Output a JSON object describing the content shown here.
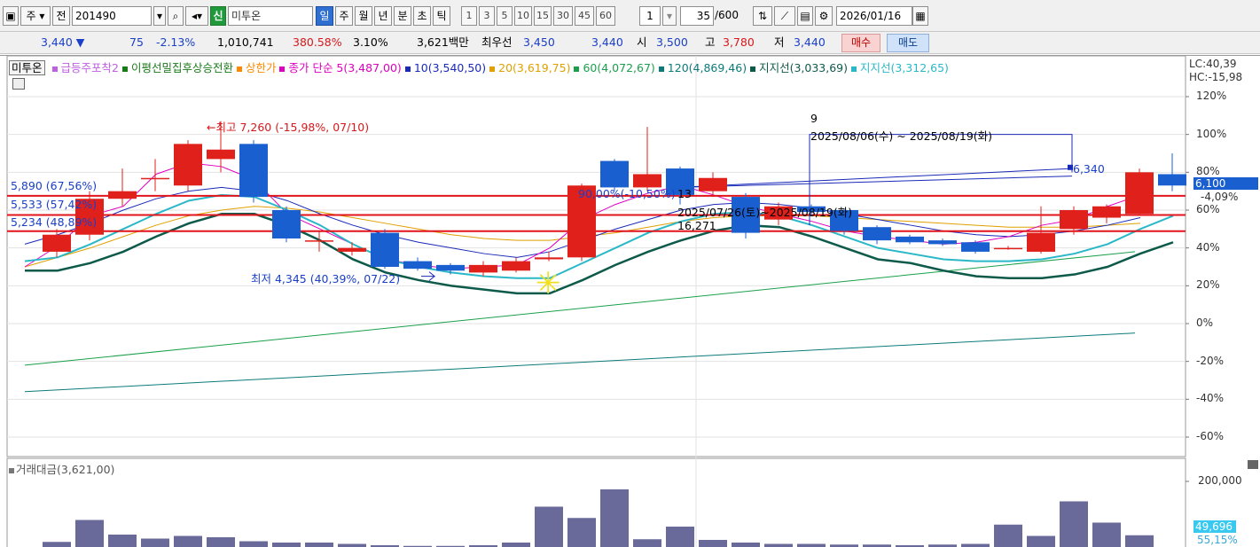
{
  "toolbar": {
    "type_label": "주",
    "prefix_label": "전",
    "code_value": "201490",
    "market_badge": "신",
    "stock_name": "미투온",
    "period_buttons": [
      "일",
      "주",
      "월",
      "년",
      "분",
      "초",
      "틱"
    ],
    "active_period": "일",
    "interval_buttons": [
      "1",
      "3",
      "5",
      "10",
      "15",
      "30",
      "45",
      "60"
    ],
    "interval_value": "1",
    "count_value": "35",
    "count_total": "/600",
    "date_value": "2026/01/16"
  },
  "info": {
    "price": "3,440",
    "change_arrow": "▼",
    "change": "75",
    "change_pct": "-2.13%",
    "volume": "1,010,741",
    "volume_ratio": "380.58%",
    "turnover": "3.10%",
    "amount": "3,621백만",
    "quote_label": "최우선",
    "ask": "3,450",
    "bid": "3,440",
    "open_label": "시",
    "open": "3,500",
    "high_label": "고",
    "high": "3,780",
    "low_label": "저",
    "low": "3,440",
    "buy_label": "매수",
    "sell_label": "매도"
  },
  "legend": {
    "name": "미투온",
    "items": [
      {
        "text": "급등주포착2",
        "color": "#c060e0"
      },
      {
        "text": "이평선밀집후상승전환",
        "color": "#1a7a1a"
      },
      {
        "text": "상한가",
        "color": "#ff8800"
      },
      {
        "text": "종가 단순 5(3,487,00)",
        "color": "#e000c0"
      },
      {
        "text": "10(3,540,50)",
        "color": "#1a2ab8"
      },
      {
        "text": "20(3,619,75)",
        "color": "#e0a000"
      },
      {
        "text": "60(4,072,67)",
        "color": "#1aa04a"
      },
      {
        "text": "120(4,869,46)",
        "color": "#0d7a7a"
      },
      {
        "text": "지지선(3,033,69)",
        "color": "#0d5a4a"
      },
      {
        "text": "지지선(3,312,65)",
        "color": "#2ab8c8"
      }
    ]
  },
  "annotations": {
    "high": "←최고 7,260 (-15,98%, 07/10)",
    "low": "최저 4,345 (40,39%, 07/22)",
    "level1": "5,890 (67,56%)",
    "level2": "5,533 (57,42%)",
    "level3": "5,234 (48,89%)",
    "range_count": "9",
    "range_dates": "2025/08/06(수) ~ 2025/08/19(화)",
    "box_label": "6,340",
    "mid_label1": "90,00%(-10,50%)",
    "mid_label2": "13",
    "mid_label3": "2025/07/26(토)~2025/08/19(화)",
    "mid_label4": "16,271"
  },
  "price_axis": {
    "lc": "LC:40,39",
    "hc": "HC:-15,98",
    "ticks": [
      "120%",
      "100%",
      "80%",
      "60%",
      "40%",
      "20%",
      "0%",
      "-20%",
      "-40%",
      "-60%"
    ],
    "current_price": "6,100",
    "current_pct": "-4,09%"
  },
  "volume_panel": {
    "label": "거래대금(3,621,00)",
    "axis_tick": "200,000",
    "current_value": "49,696",
    "current_pct": "55,15%"
  },
  "colors": {
    "up": "#e0201a",
    "down": "#1a5fd0",
    "vol_bar": "#6a6a9a"
  },
  "chart_data": {
    "type": "candlestick",
    "candles": [
      {
        "o": 38,
        "c": 47,
        "h": 50,
        "l": 35
      },
      {
        "o": 47,
        "c": 66,
        "h": 70,
        "l": 44
      },
      {
        "o": 66,
        "c": 70,
        "h": 82,
        "l": 62
      },
      {
        "o": 77,
        "c": 77,
        "h": 87,
        "l": 70
      },
      {
        "o": 73,
        "c": 95,
        "h": 97,
        "l": 70
      },
      {
        "o": 87,
        "c": 92,
        "h": 107,
        "l": 80
      },
      {
        "o": 95,
        "c": 67,
        "h": 97,
        "l": 64
      },
      {
        "o": 60,
        "c": 45,
        "h": 62,
        "l": 43
      },
      {
        "o": 44,
        "c": 44,
        "h": 49,
        "l": 38
      },
      {
        "o": 38,
        "c": 40,
        "h": 43,
        "l": 36
      },
      {
        "o": 48,
        "c": 30,
        "h": 50,
        "l": 29
      },
      {
        "o": 33,
        "c": 29,
        "h": 35,
        "l": 28
      },
      {
        "o": 31,
        "c": 28,
        "h": 32,
        "l": 26
      },
      {
        "o": 27,
        "c": 31,
        "h": 33,
        "l": 25
      },
      {
        "o": 28,
        "c": 33,
        "h": 35,
        "l": 27
      },
      {
        "o": 34,
        "c": 35,
        "h": 38,
        "l": 33
      },
      {
        "o": 35,
        "c": 73,
        "h": 74,
        "l": 33
      },
      {
        "o": 86,
        "c": 72,
        "h": 87,
        "l": 70
      },
      {
        "o": 72,
        "c": 79,
        "h": 104,
        "l": 70
      },
      {
        "o": 82,
        "c": 68,
        "h": 83,
        "l": 63
      },
      {
        "o": 70,
        "c": 77,
        "h": 80,
        "l": 67
      },
      {
        "o": 67,
        "c": 48,
        "h": 69,
        "l": 45
      },
      {
        "o": 55,
        "c": 62,
        "h": 64,
        "l": 52
      },
      {
        "o": 62,
        "c": 59,
        "h": 63,
        "l": 57
      },
      {
        "o": 60,
        "c": 49,
        "h": 61,
        "l": 47
      },
      {
        "o": 51,
        "c": 44,
        "h": 52,
        "l": 42
      },
      {
        "o": 46,
        "c": 43,
        "h": 47,
        "l": 42
      },
      {
        "o": 44,
        "c": 42,
        "h": 45,
        "l": 41
      },
      {
        "o": 43,
        "c": 38,
        "h": 44,
        "l": 37
      },
      {
        "o": 40,
        "c": 40,
        "h": 41,
        "l": 39
      },
      {
        "o": 38,
        "c": 48,
        "h": 62,
        "l": 37
      },
      {
        "o": 50,
        "c": 60,
        "h": 62,
        "l": 47
      },
      {
        "o": 56,
        "c": 62,
        "h": 63,
        "l": 53
      },
      {
        "o": 58,
        "c": 80,
        "h": 82,
        "l": 57
      },
      {
        "o": 79,
        "c": 73,
        "h": 90,
        "l": 70
      }
    ],
    "volume": [
      9,
      42,
      20,
      14,
      18,
      16,
      10,
      8,
      8,
      6,
      4,
      3,
      3,
      4,
      8,
      62,
      45,
      88,
      13,
      32,
      12,
      8,
      6,
      6,
      5,
      5,
      4,
      5,
      6,
      35,
      18,
      70,
      38,
      19
    ],
    "ma5": [
      30,
      41,
      57,
      62,
      79,
      85,
      83,
      76,
      58,
      50,
      42,
      34,
      31,
      29,
      30,
      31,
      40,
      55,
      63,
      69,
      73,
      68,
      62,
      58,
      54,
      49,
      46,
      44,
      42,
      43,
      46,
      52,
      55,
      62,
      68
    ],
    "ma10": [
      42,
      47,
      53,
      60,
      66,
      70,
      72,
      70,
      65,
      58,
      52,
      47,
      43,
      40,
      37,
      35,
      38,
      44,
      50,
      55,
      60,
      63,
      64,
      63,
      61,
      58,
      55,
      52,
      49,
      47,
      46,
      47,
      49,
      52,
      56
    ],
    "ma20": [
      30,
      35,
      40,
      46,
      52,
      57,
      60,
      62,
      61,
      59,
      56,
      53,
      50,
      47,
      45,
      44,
      44,
      46,
      48,
      51,
      54,
      56,
      57,
      57,
      57,
      56,
      55,
      54,
      53,
      52,
      51,
      51,
      51,
      52,
      53
    ],
    "support1": [
      28,
      28,
      32,
      38,
      46,
      53,
      58,
      58,
      52,
      44,
      34,
      27,
      23,
      20,
      18,
      16,
      16,
      23,
      31,
      38,
      44,
      49,
      52,
      51,
      46,
      40,
      34,
      32,
      28,
      25,
      24,
      24,
      26,
      30,
      37,
      43
    ],
    "support2": [
      33,
      35,
      42,
      50,
      58,
      65,
      68,
      67,
      60,
      52,
      42,
      34,
      30,
      27,
      25,
      24,
      24,
      32,
      40,
      48,
      54,
      58,
      59,
      57,
      52,
      46,
      40,
      37,
      34,
      33,
      33,
      34,
      37,
      42,
      50,
      57
    ],
    "ma60_start": -22,
    "ma60_end": 38,
    "ma120_start": -36,
    "ma120_end": -5,
    "levels": [
      67.56,
      57.42,
      48.89
    ],
    "ylim": [
      -70,
      130
    ]
  }
}
